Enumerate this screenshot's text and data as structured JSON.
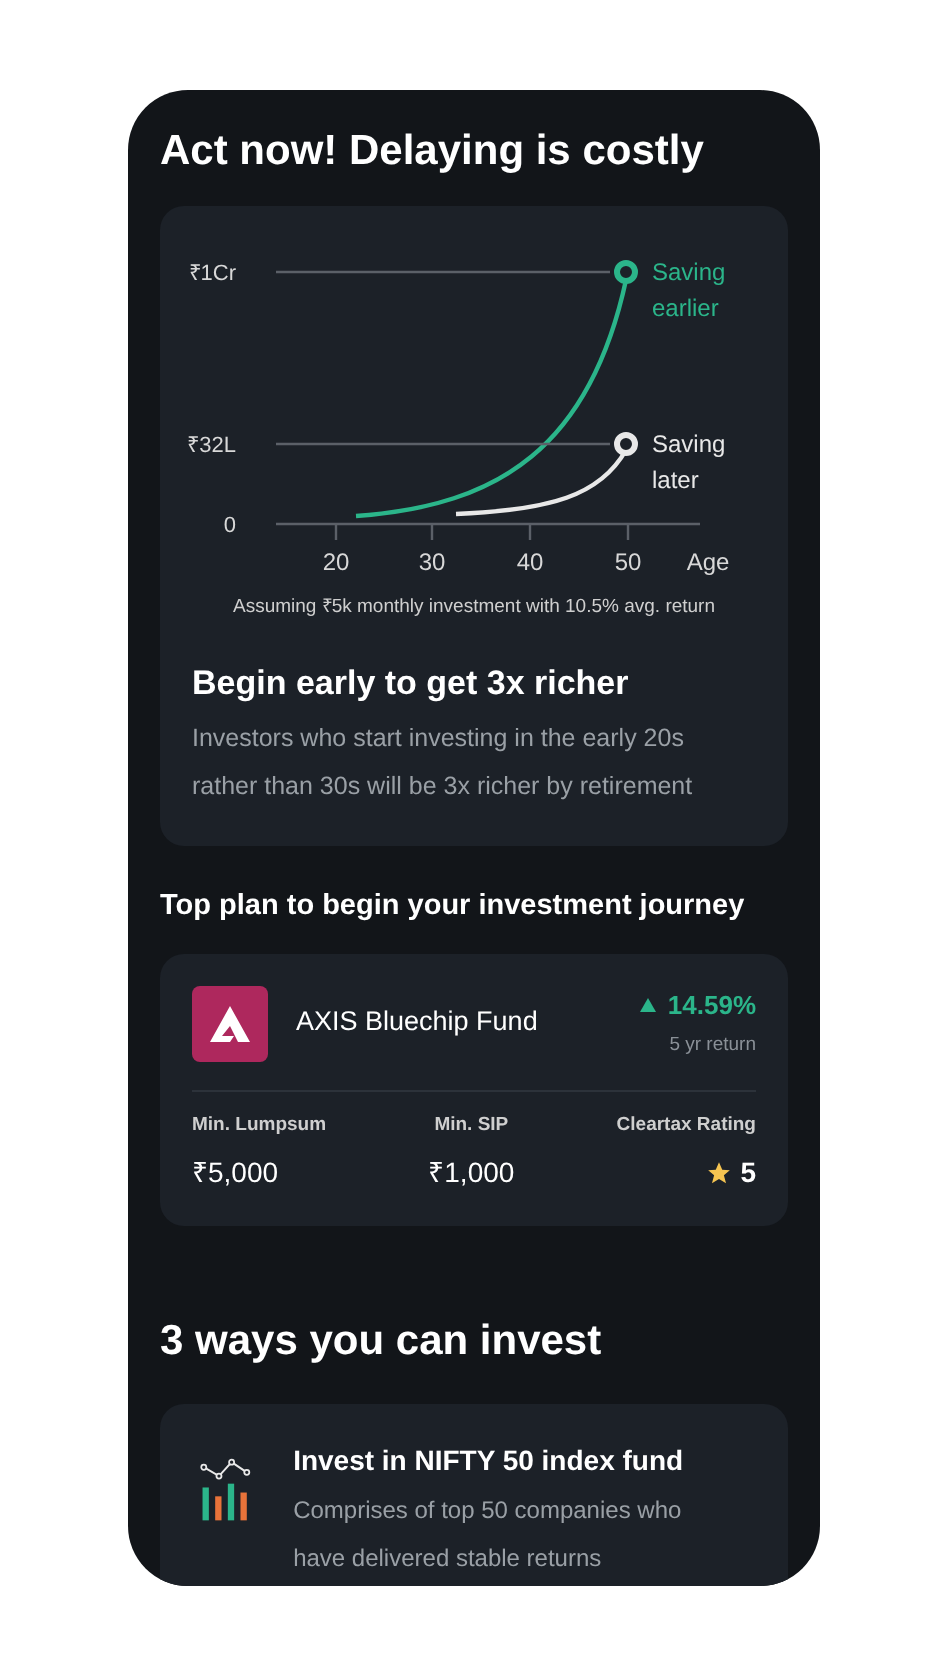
{
  "title": "Act now! Delaying is costly",
  "growth_card": {
    "graph": {
      "y_labels": [
        "₹1Cr",
        "₹32L",
        "0"
      ],
      "x_labels": [
        "20",
        "30",
        "40",
        "50"
      ],
      "x_axis_label": "Age",
      "series": [
        {
          "label_lines": [
            "Saving",
            "earlier"
          ],
          "color": "#2bb58a"
        },
        {
          "label_lines": [
            "Saving",
            "later"
          ],
          "color": "#e8e8e8"
        }
      ]
    },
    "caption": "Assuming ₹5k monthly investment with 10.5% avg. return",
    "heading": "Begin early to get 3x richer",
    "body": "Investors who start investing in the early 20s rather than 30s will be 3x richer by retirement"
  },
  "plan_heading": "Top plan to begin your investment journey",
  "fund": {
    "name": "AXIS Bluechip Fund",
    "return": "14.59%",
    "return_label": "5 yr return",
    "stats": [
      {
        "label": "Min. Lumpsum",
        "value": "₹5,000",
        "kind": "text"
      },
      {
        "label": "Min. SIP",
        "value": "₹1,000",
        "kind": "text"
      },
      {
        "label": "Cleartax Rating",
        "value": "5",
        "kind": "rating"
      }
    ]
  },
  "ways_heading": "3 ways you can invest",
  "ways": [
    {
      "title": "Invest in NIFTY 50 index fund",
      "body": "Comprises of top 50 companies who have delivered stable returns"
    }
  ]
}
